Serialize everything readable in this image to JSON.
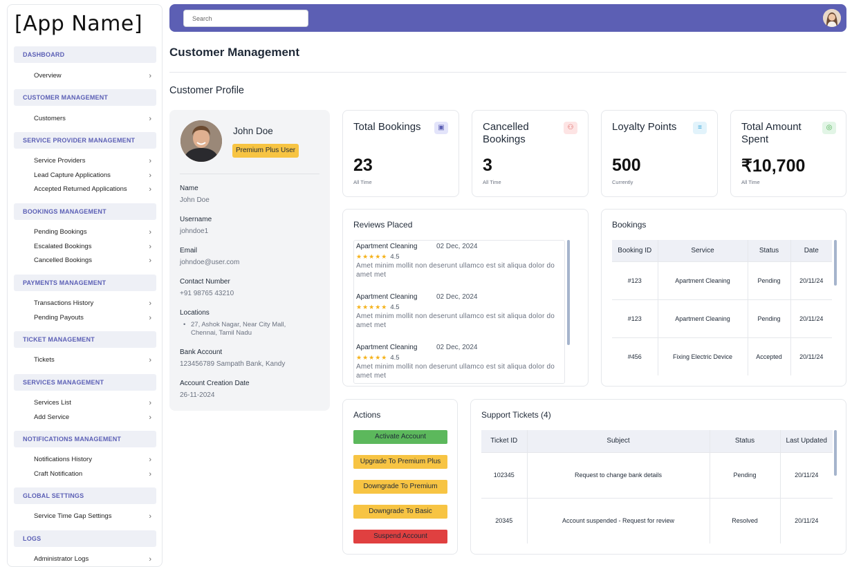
{
  "app": {
    "name": "[App Name]"
  },
  "sidebar": {
    "sections": [
      {
        "title": "DASHBOARD",
        "items": [
          "Overview"
        ]
      },
      {
        "title": "CUSTOMER MANAGEMENT",
        "items": [
          "Customers"
        ]
      },
      {
        "title": "SERVICE PROVIDER MANAGEMENT",
        "items": [
          "Service Providers",
          "Lead Capture Applications",
          "Accepted Returned Applications"
        ]
      },
      {
        "title": "BOOKINGS MANAGEMENT",
        "items": [
          "Pending Bookings",
          "Escalated Bookings",
          "Cancelled Bookings"
        ]
      },
      {
        "title": "PAYMENTS MANAGEMENT",
        "items": [
          "Transactions History",
          "Pending Payouts"
        ]
      },
      {
        "title": "TICKET MANAGEMENT",
        "items": [
          "Tickets"
        ]
      },
      {
        "title": "SERVICES MANAGEMENT",
        "items": [
          "Services List",
          "Add Service"
        ]
      },
      {
        "title": "NOTIFICATIONS MANAGEMENT",
        "items": [
          "Notifications History",
          "Craft Notification"
        ]
      },
      {
        "title": "GLOBAL SETTINGS",
        "items": [
          "Service Time Gap Settings"
        ]
      },
      {
        "title": "LOGS",
        "items": [
          "Administrator Logs"
        ]
      }
    ]
  },
  "topbar": {
    "search_placeholder": "Search"
  },
  "page": {
    "title": "Customer Management",
    "subtitle": "Customer Profile"
  },
  "profile": {
    "name": "John Doe",
    "badge": "Premium Plus User",
    "fields": {
      "name_label": "Name",
      "name_value": "John Doe",
      "username_label": "Username",
      "username_value": "johndoe1",
      "email_label": "Email",
      "email_value": "johndoe@user.com",
      "contact_label": "Contact Number",
      "contact_value": "+91 98765 43210",
      "locations_label": "Locations",
      "location_1": "27, Ashok Nagar, Near City Mall, Chennai, Tamil Nadu",
      "bank_label": "Bank Account",
      "bank_value": "123456789 Sampath Bank, Kandy",
      "created_label": "Account Creation Date",
      "created_value": "26-11-2024"
    }
  },
  "stats": [
    {
      "title": "Total Bookings",
      "value": "23",
      "sub": "All Time",
      "icon": "briefcase-icon",
      "icon_bg": "#e3e4fa",
      "icon_color": "#5c5fb4"
    },
    {
      "title": "Cancelled Bookings",
      "value": "3",
      "sub": "All Time",
      "icon": "users-icon",
      "icon_bg": "#fde4e4",
      "icon_color": "#d9534f"
    },
    {
      "title": "Loyalty Points",
      "value": "500",
      "sub": "Currently",
      "icon": "list-icon",
      "icon_bg": "#e2f3fb",
      "icon_color": "#3aa7d8"
    },
    {
      "title": "Total Amount Spent",
      "value": "₹10,700",
      "sub": "All Time",
      "icon": "target-icon",
      "icon_bg": "#e2f5e6",
      "icon_color": "#4caf50"
    }
  ],
  "reviews": {
    "title": "Reviews Placed",
    "items": [
      {
        "service": "Apartment Cleaning",
        "date": "02 Dec, 2024",
        "stars": "★★★★★",
        "rating": "4.5",
        "text": "Amet minim mollit non deserunt ullamco est sit aliqua dolor do amet met"
      },
      {
        "service": "Apartment Cleaning",
        "date": "02 Dec, 2024",
        "stars": "★★★★★",
        "rating": "4.5",
        "text": "Amet minim mollit non deserunt ullamco est sit aliqua dolor do amet met"
      },
      {
        "service": "Apartment Cleaning",
        "date": "02 Dec, 2024",
        "stars": "★★★★★",
        "rating": "4.5",
        "text": "Amet minim mollit non deserunt ullamco est sit aliqua dolor do amet met"
      }
    ]
  },
  "bookings": {
    "title": "Bookings",
    "columns": [
      "Booking ID",
      "Service",
      "Status",
      "Date"
    ],
    "rows": [
      [
        "#123",
        "Apartment Cleaning",
        "Pending",
        "20/11/24"
      ],
      [
        "#123",
        "Apartment Cleaning",
        "Pending",
        "20/11/24"
      ],
      [
        "#456",
        "Fixing Electric Device",
        "Accepted",
        "20/11/24"
      ]
    ]
  },
  "actions": {
    "title": "Actions",
    "buttons": [
      {
        "label": "Activate Account",
        "color": "#5cb85c"
      },
      {
        "label": "Upgrade To Premium Plus",
        "color": "#f7c443"
      },
      {
        "label": "Downgrade To Premium",
        "color": "#f7c443"
      },
      {
        "label": "Downgrade To Basic",
        "color": "#f7c443"
      },
      {
        "label": "Suspend Account",
        "color": "#e04040"
      }
    ]
  },
  "tickets": {
    "title": "Support Tickets (4)",
    "columns": [
      "Ticket ID",
      "Subject",
      "Status",
      "Last Updated"
    ],
    "rows": [
      [
        "102345",
        "Request to change bank details",
        "Pending",
        "20/11/24"
      ],
      [
        "20345",
        "Account suspended - Request for review",
        "Resolved",
        "20/11/24"
      ]
    ]
  }
}
